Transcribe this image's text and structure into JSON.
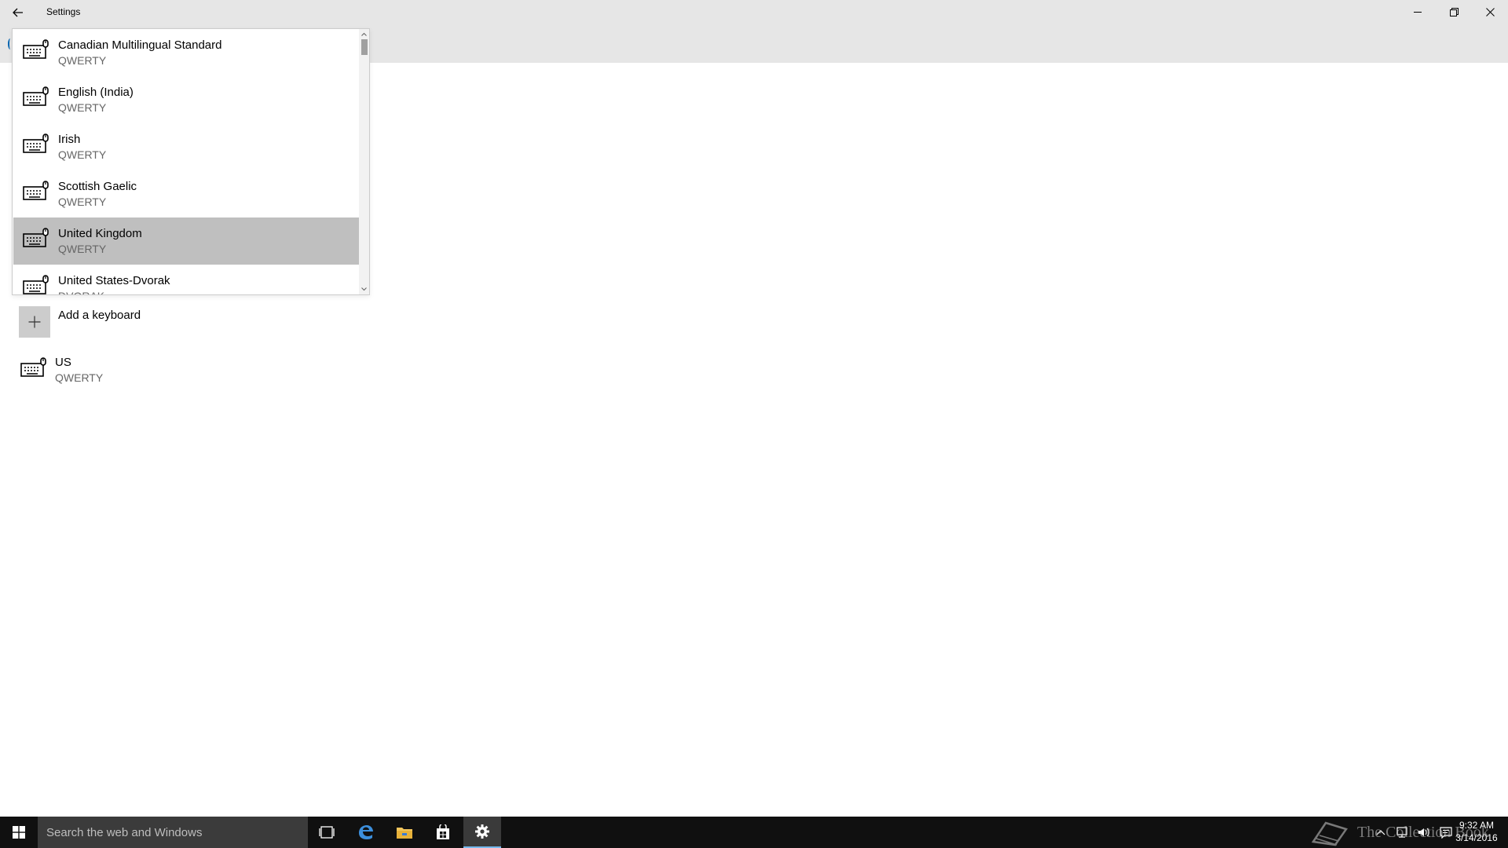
{
  "window": {
    "title": "Settings"
  },
  "dropdown": {
    "items": [
      {
        "name": "Canadian Multilingual Standard",
        "layout": "QWERTY",
        "selected": false
      },
      {
        "name": "English (India)",
        "layout": "QWERTY",
        "selected": false
      },
      {
        "name": "Irish",
        "layout": "QWERTY",
        "selected": false
      },
      {
        "name": "Scottish Gaelic",
        "layout": "QWERTY",
        "selected": false
      },
      {
        "name": "United Kingdom",
        "layout": "QWERTY",
        "selected": true
      },
      {
        "name": "United States-Dvorak",
        "layout": "DVORAK",
        "selected": false
      }
    ]
  },
  "add_keyboard": {
    "label": "Add a keyboard"
  },
  "installed_keyboard": {
    "name": "US",
    "layout": "QWERTY"
  },
  "taskbar": {
    "search_placeholder": "Search the web and Windows",
    "clock_time": "9:32 AM",
    "clock_date": "3/14/2016",
    "watermark_text": "The Collection Book"
  },
  "colors": {
    "titlebar_bg": "#e6e6e6",
    "selected_item_bg": "#bfbfbf",
    "taskbar_bg": "#101010",
    "search_bg": "#3b3b3b",
    "accent": "#76b9ed"
  },
  "icons": {
    "back": "back-arrow-icon",
    "minimize": "minimize-icon",
    "maximize": "restore-icon",
    "close": "close-icon",
    "keyboard": "keyboard-icon",
    "add": "plus-icon",
    "start": "windows-logo-icon",
    "task_view": "task-view-icon",
    "edge": "edge-browser-icon",
    "explorer": "file-explorer-icon",
    "store": "store-icon",
    "settings": "gear-icon"
  }
}
